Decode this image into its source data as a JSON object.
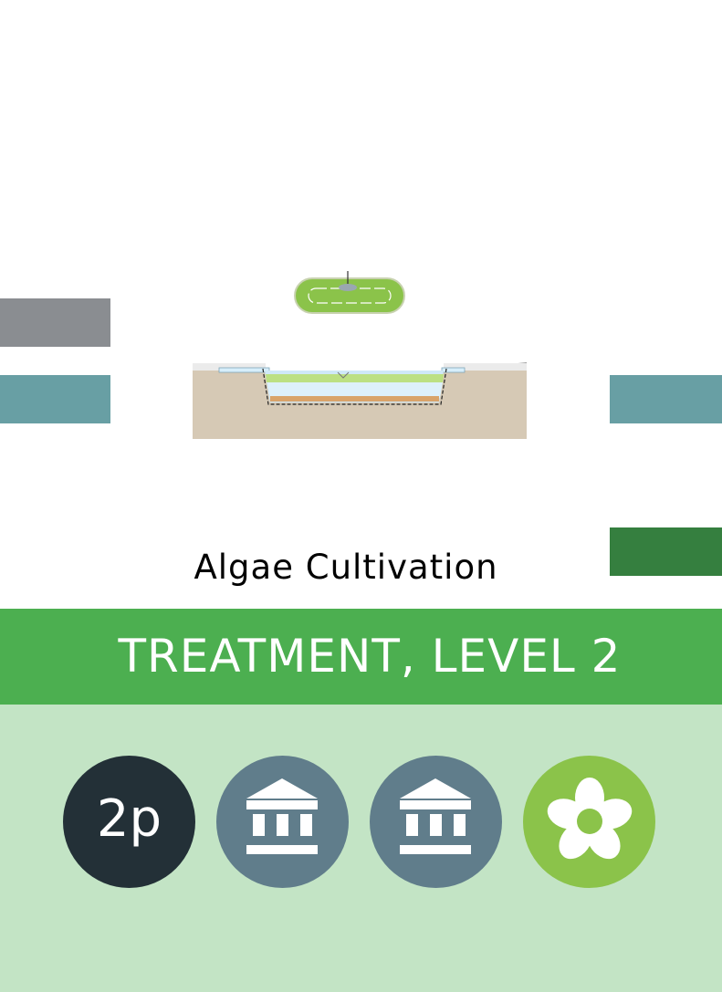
{
  "card": {
    "title": "Algae Cultivation",
    "banner": "TREATMENT, LEVEL 2",
    "people_badge": "2p"
  },
  "icons": [
    "bank-icon",
    "bank-icon",
    "flower-icon"
  ],
  "colors": {
    "grey_tab": "#8a8d91",
    "teal_tab": "#689fa4",
    "dark_green_tab": "#357f3f",
    "banner_green": "#4caf50",
    "footer_mint": "#c3e4c5",
    "badge_dark": "#233037",
    "badge_slate": "#607d8b",
    "badge_lime": "#8bc34a",
    "soil": "#d6c9b5"
  }
}
